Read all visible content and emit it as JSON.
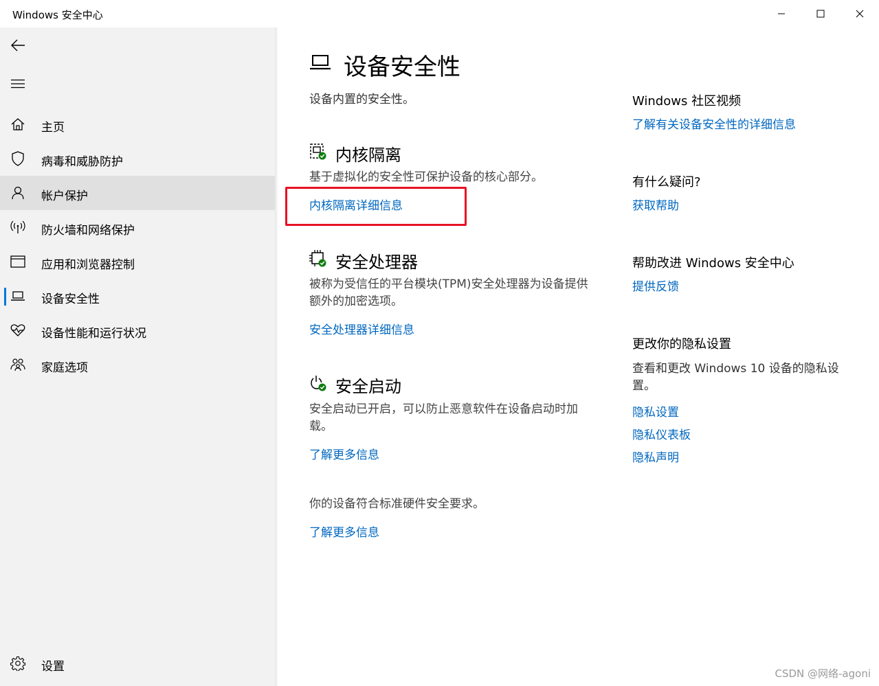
{
  "window": {
    "title": "Windows 安全中心",
    "controls": [
      "minimize",
      "maximize",
      "close"
    ]
  },
  "sidebar": {
    "back_icon": "back-arrow-icon",
    "menu_icon": "hamburger-icon",
    "items": [
      {
        "label": "主页",
        "icon": "home-icon"
      },
      {
        "label": "病毒和威胁防护",
        "icon": "shield-icon"
      },
      {
        "label": "帐户保护",
        "icon": "person-icon",
        "hovered": true
      },
      {
        "label": "防火墙和网络保护",
        "icon": "wifi-antenna-icon"
      },
      {
        "label": "应用和浏览器控制",
        "icon": "app-window-icon"
      },
      {
        "label": "设备安全性",
        "icon": "laptop-icon",
        "selected": true
      },
      {
        "label": "设备性能和运行状况",
        "icon": "heart-pulse-icon"
      },
      {
        "label": "家庭选项",
        "icon": "family-icon"
      }
    ],
    "settings_label": "设置"
  },
  "main": {
    "title": "设备安全性",
    "subtitle": "设备内置的安全性。",
    "sections": [
      {
        "title": "内核隔离",
        "description": "基于虚拟化的安全性可保护设备的核心部分。",
        "link": "内核隔离详细信息"
      },
      {
        "title": "安全处理器",
        "description": "被称为受信任的平台模块(TPM)安全处理器为设备提供额外的加密选项。",
        "link": "安全处理器详细信息"
      },
      {
        "title": "安全启动",
        "description": "安全启动已开启，可以防止恶意软件在设备启动时加载。",
        "link": "了解更多信息"
      }
    ],
    "footer_text": "你的设备符合标准硬件安全要求。",
    "footer_link": "了解更多信息"
  },
  "right_column": {
    "community": {
      "heading": "Windows 社区视频",
      "link": "了解有关设备安全性的详细信息"
    },
    "question": {
      "heading": "有什么疑问?",
      "link": "获取帮助"
    },
    "improve": {
      "heading": "帮助改进 Windows 安全中心",
      "link": "提供反馈"
    },
    "privacy": {
      "heading": "更改你的隐私设置",
      "description": "查看和更改 Windows 10 设备的隐私设置。",
      "links": [
        "隐私设置",
        "隐私仪表板",
        "隐私声明"
      ]
    }
  },
  "watermark": "CSDN @网络-agoni",
  "colors": {
    "accent": "#0078d7",
    "link": "#0067c0",
    "highlight": "#e81123",
    "status_ok": "#107c10"
  }
}
